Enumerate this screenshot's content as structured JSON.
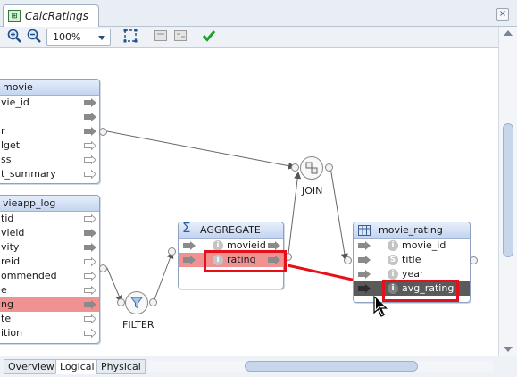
{
  "editor_tab": {
    "title": "CalcRatings"
  },
  "toolbar": {
    "zoom_value": "100%"
  },
  "movie_table": {
    "header": "movie",
    "rows": [
      "vie_id",
      "",
      "r",
      "lget",
      "ss",
      "t_summary"
    ]
  },
  "log_table": {
    "header": "vieapp_log",
    "rows": [
      "tid",
      "vieid",
      "vity",
      "reid",
      "ommended",
      "e",
      "ng",
      "te",
      "ition"
    ]
  },
  "aggregate": {
    "header": "AGGREGATE",
    "rows": [
      "movieid",
      "rating"
    ],
    "row_icon": "i"
  },
  "movie_rating": {
    "header": "movie_rating",
    "rows": [
      "movie_id",
      "title",
      "year",
      "avg_rating"
    ],
    "row_icons": [
      "i",
      "S",
      "i",
      "i"
    ]
  },
  "operators": {
    "join_label": "JOIN",
    "filter_label": "FILTER"
  },
  "bottom_tabs": [
    "Overview",
    "Logical",
    "Physical"
  ],
  "colors": {
    "highlight": "#e4111b",
    "selected_row": "#f09292",
    "dark_row": "#5a5a5a"
  }
}
